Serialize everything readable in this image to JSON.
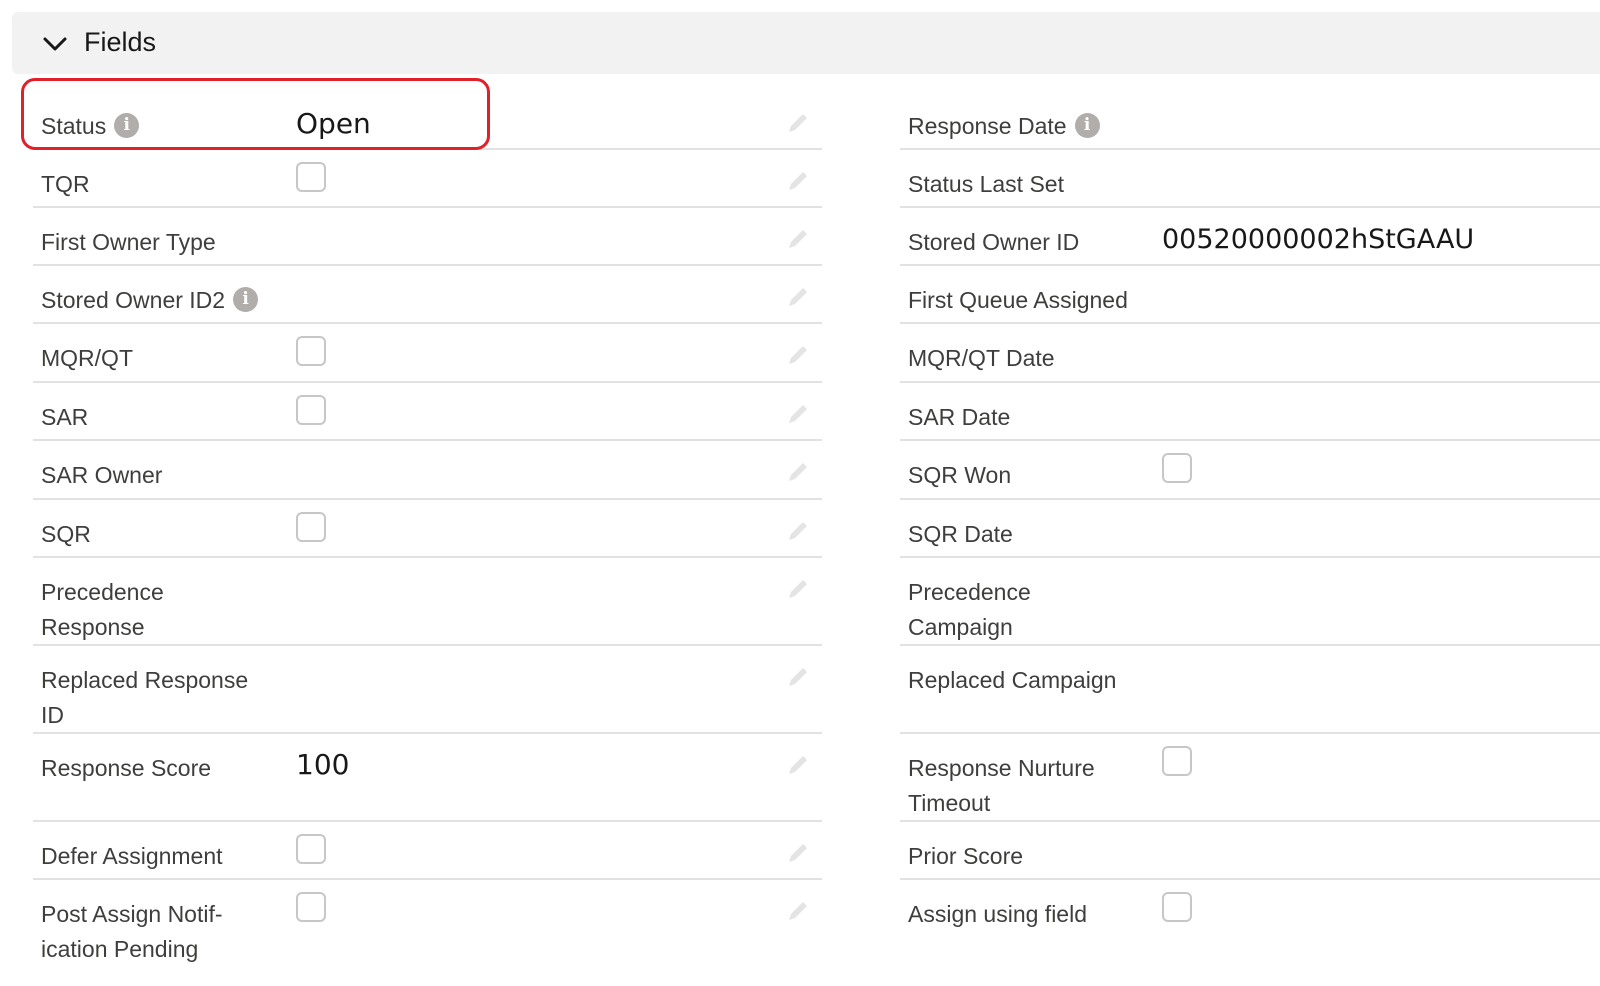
{
  "section": {
    "title": "Fields"
  },
  "left": {
    "status": {
      "label": "Status",
      "value": "Open"
    },
    "tqr": {
      "label": "TQR"
    },
    "first_owner_type": {
      "label": "First Owner Type"
    },
    "stored_owner_id2": {
      "label": "Stored Owner ID2"
    },
    "mqr_qt": {
      "label": "MQR/QT"
    },
    "sar": {
      "label": "SAR"
    },
    "sar_owner": {
      "label": "SAR Owner"
    },
    "sqr": {
      "label": "SQR"
    },
    "precedence_response": {
      "label": "Precedence Response"
    },
    "replaced_response_id": {
      "label": "Replaced Response ID"
    },
    "response_score": {
      "label": "Response Score",
      "value": "100"
    },
    "defer_assignment": {
      "label": "Defer Assignment"
    },
    "post_assign": {
      "label": "Post Assign Notif-ication Pending"
    }
  },
  "right": {
    "response_date": {
      "label": "Response Date"
    },
    "status_last_set": {
      "label": "Status Last Set"
    },
    "stored_owner_id": {
      "label": "Stored Owner ID",
      "value": "00520000002hStGAAU"
    },
    "first_queue_assigned": {
      "label": "First Queue Assigned"
    },
    "mqr_qt_date": {
      "label": "MQR/QT Date"
    },
    "sar_date": {
      "label": "SAR Date"
    },
    "sqr_won": {
      "label": "SQR Won"
    },
    "sqr_date": {
      "label": "SQR Date"
    },
    "precedence_campaign": {
      "label": "Precedence Campaign"
    },
    "replaced_campaign": {
      "label": "Replaced Campaign"
    },
    "response_nurture_timeout": {
      "label": "Response Nurture Timeout"
    },
    "prior_score": {
      "label": "Prior Score"
    },
    "assign_using_field": {
      "label": "Assign using field"
    }
  },
  "icons": {
    "info": "info-icon",
    "edit": "pencil-icon",
    "collapse": "chevron-down-icon"
  },
  "colors": {
    "highlight": "#e0202b",
    "header_bg": "#f3f2f2",
    "divider": "#e2e2e2"
  }
}
